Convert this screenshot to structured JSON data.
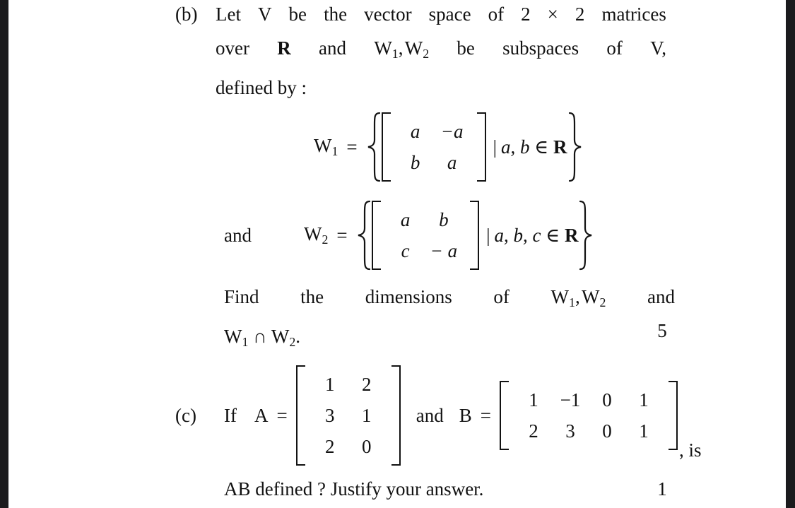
{
  "page": {
    "background": "#ffffff",
    "edge_color": "#1b1b1d",
    "text_color": "#121212"
  },
  "questions": [
    {
      "label": "(b)",
      "lines": [
        "Let V be the vector space of 2 × 2 matrices",
        "over R and W1, W2 be subspaces of V,",
        "defined by :"
      ],
      "line1_words": [
        "Let",
        "V",
        "be",
        "the",
        "vector",
        "space",
        "of",
        "2",
        "×",
        "2",
        "matrices"
      ],
      "line2_words": [
        "over",
        "R",
        "and",
        "W1, W2",
        "be",
        "subspaces",
        "of",
        "V,"
      ],
      "line3": "defined by :",
      "definition_w1": {
        "name": "W",
        "subscript": "1",
        "equals": "=",
        "matrix": [
          [
            "a",
            "−a"
          ],
          [
            "b",
            "a"
          ]
        ],
        "condition_bar": "|",
        "condition": "a, b",
        "membership": "∈",
        "field": "R"
      },
      "and_label": "and",
      "definition_w2": {
        "name": "W",
        "subscript": "2",
        "equals": "=",
        "matrix": [
          [
            "a",
            "b"
          ],
          [
            "c",
            "− a"
          ]
        ],
        "condition_bar": "|",
        "condition": "a, b, c",
        "membership": "∈",
        "field": "R"
      },
      "find_line_words": [
        "Find",
        "the",
        "dimensions",
        "of",
        "W1, W2",
        "and"
      ],
      "find_line2": "W1 ∩ W2.",
      "marks": "5"
    },
    {
      "label": "(c)",
      "prefix": "If",
      "matrix_a_name": "A",
      "equals": "=",
      "matrix_a": [
        [
          "1",
          "2"
        ],
        [
          "3",
          "1"
        ],
        [
          "2",
          "0"
        ]
      ],
      "conjunction": "and",
      "matrix_b_name": "B",
      "matrix_b": [
        [
          "1",
          "−1",
          "0",
          "1"
        ],
        [
          "2",
          "3",
          "0",
          "1"
        ]
      ],
      "suffix": ", is",
      "final_line": "AB defined ? Justify your answer.",
      "marks": "1"
    }
  ],
  "glyphs": {
    "intersection": "∩",
    "multiplication": "×",
    "element_of": "∈",
    "vertical_bar": "|",
    "minus": "−"
  }
}
